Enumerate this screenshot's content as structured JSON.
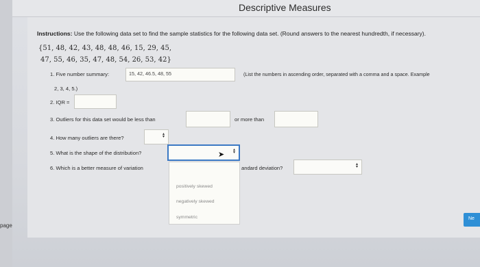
{
  "header": {
    "title": "Descriptive Measures"
  },
  "instructions": {
    "label": "Instructions:",
    "text": "Use the following data set to find the sample statistics for the following data set. (Round answers to the nearest hundredth, if necessary).",
    "data_line1": "{51, 48, 42, 43, 48, 48, 46, 15, 29, 45,",
    "data_line2": "47, 55, 46, 35, 47, 48, 54, 26, 53, 42}"
  },
  "questions": {
    "q1": {
      "label": "1. Five number summary:",
      "value": "15, 42, 46.5, 48, 55",
      "hint": "(List the numbers in ascending order, separated with a comma and a space. Example",
      "example": "2, 3, 4, 5.)"
    },
    "q2": {
      "label": "2. IQR =",
      "value": ""
    },
    "q3": {
      "label": "3. Outliers for this data set would be less than",
      "middle": "or more than",
      "value_low": "",
      "value_high": ""
    },
    "q4": {
      "label": "4. How many outliers are there?",
      "selected": ""
    },
    "q5": {
      "label": "5. What is the shape of the distribution?",
      "selected": "",
      "options": [
        "positively skewed",
        "negatively skewed",
        "symmetric"
      ]
    },
    "q6": {
      "label": "6. Which is a better measure of variation",
      "tail": "andard deviation?",
      "selected": ""
    }
  },
  "footer": {
    "next_label": "Ne",
    "page_label": "page"
  },
  "colors": {
    "accent": "#2e8fd6",
    "focus": "#3a78c4"
  }
}
